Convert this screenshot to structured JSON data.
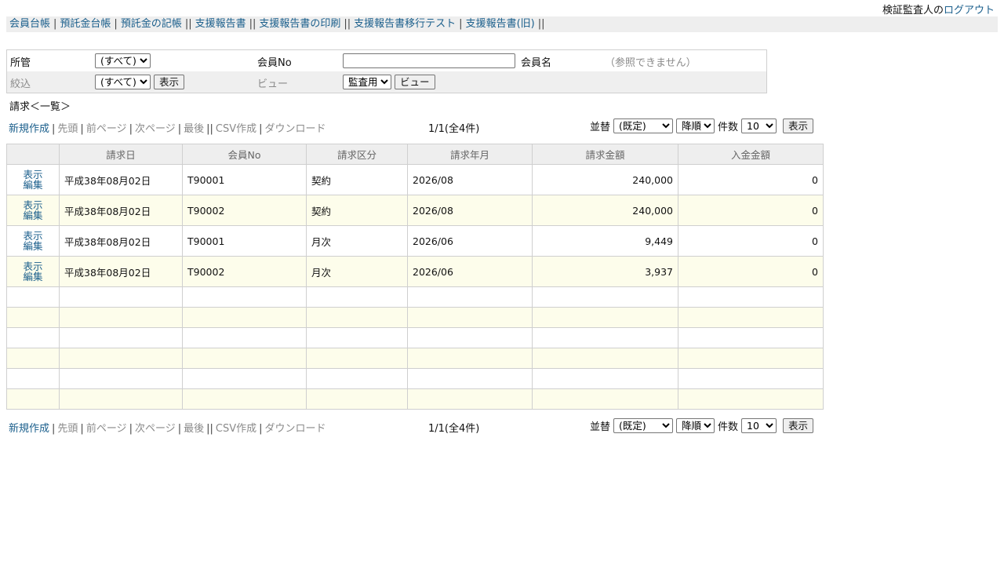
{
  "user": {
    "name_text": "検証監査人の",
    "logout_label": "ログアウト"
  },
  "menu": [
    {
      "label": "会員台帳",
      "sep": "|"
    },
    {
      "label": "預託金台帳",
      "sep": "|"
    },
    {
      "label": "預託金の記帳",
      "sep": "||"
    },
    {
      "label": "支援報告書",
      "sep": "||"
    },
    {
      "label": "支援報告書の印刷",
      "sep": "||"
    },
    {
      "label": "支援報告書移行テスト",
      "sep": "|"
    },
    {
      "label": "支援報告書(旧)",
      "sep": "||"
    }
  ],
  "search": {
    "shokan_label": "所管",
    "shokan_value": "(すべて)",
    "member_no_label": "会員No",
    "member_no_value": "",
    "member_name_label": "会員名",
    "member_name_note": "（参照できません）",
    "filter_label": "絞込",
    "filter_value": "(すべて)",
    "show_button": "表示",
    "view_label": "ビュー",
    "view_value": "監査用",
    "view_button": "ビュー"
  },
  "caption": "請求＜一覧＞",
  "pager": {
    "new_label": "新規作成",
    "first_label": "先頭",
    "prev_label": "前ページ",
    "next_label": "次ページ",
    "last_label": "最後",
    "csv_label": "CSV作成",
    "download_label": "ダウンロード",
    "count_text": "1/1(全4件)",
    "sort_label": "並替",
    "sort_value": "(既定)",
    "order_value": "降順",
    "per_page_label": "件数",
    "per_page_value": "10",
    "show_button": "表示"
  },
  "table": {
    "headers": [
      "",
      "請求日",
      "会員No",
      "請求区分",
      "請求年月",
      "請求金額",
      "入金金額"
    ],
    "action_view": "表示",
    "action_edit": "編集",
    "rows": [
      {
        "date": "平成38年08月02日",
        "member_no": "T90001",
        "category": "契約",
        "month": "2026/08",
        "amount": "240,000",
        "paid": "0"
      },
      {
        "date": "平成38年08月02日",
        "member_no": "T90002",
        "category": "契約",
        "month": "2026/08",
        "amount": "240,000",
        "paid": "0"
      },
      {
        "date": "平成38年08月02日",
        "member_no": "T90001",
        "category": "月次",
        "month": "2026/06",
        "amount": "9,449",
        "paid": "0"
      },
      {
        "date": "平成38年08月02日",
        "member_no": "T90002",
        "category": "月次",
        "month": "2026/06",
        "amount": "3,937",
        "paid": "0"
      }
    ],
    "empty_rows": 6
  }
}
